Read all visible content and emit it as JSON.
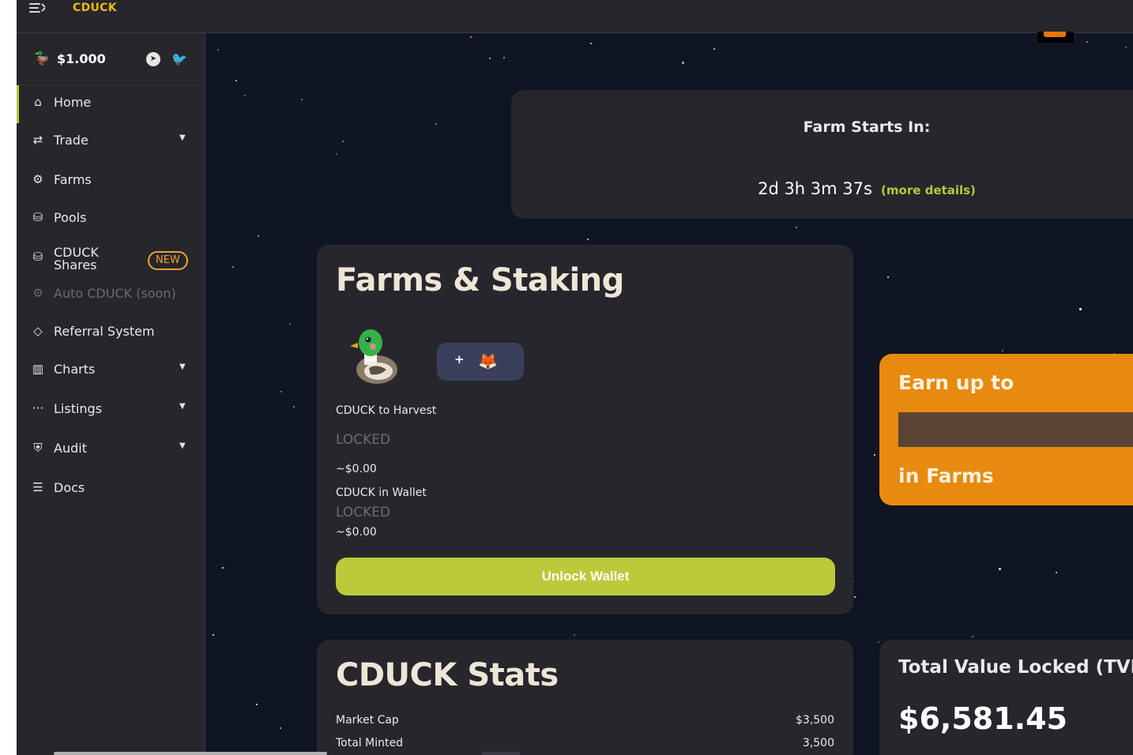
{
  "app": {
    "brand": "CDUCK"
  },
  "sidebar": {
    "price": "$1.000",
    "items": [
      {
        "label": "Home",
        "icon": "home-icon"
      },
      {
        "label": "Trade",
        "icon": "trade-icon"
      },
      {
        "label": "Farms",
        "icon": "tractor-icon"
      },
      {
        "label": "Pools",
        "icon": "pool-icon"
      },
      {
        "label_line1": "CDUCK",
        "label_line2": "Shares",
        "icon": "pool-icon",
        "badge": "NEW"
      },
      {
        "label": "Auto CDUCK (soon)",
        "icon": "tractor-icon"
      },
      {
        "label": "Referral System",
        "icon": "ticket-icon"
      },
      {
        "label": "Charts",
        "icon": "chart-icon"
      },
      {
        "label": "Listings",
        "icon": "more-icon"
      },
      {
        "label": "Audit",
        "icon": "shield-icon"
      },
      {
        "label": "Docs",
        "icon": "docs-icon"
      }
    ]
  },
  "countdown": {
    "heading": "Farm Starts In:",
    "timer": "2d 3h 3m 37s",
    "more_details": "(more details)"
  },
  "farms": {
    "title": "Farms & Staking",
    "add_token_plus": "+",
    "harvest_label": "CDUCK to Harvest",
    "harvest_value": "LOCKED",
    "harvest_usd": "~$0.00",
    "wallet_label": "CDUCK in Wallet",
    "wallet_value": "LOCKED",
    "wallet_usd": "~$0.00",
    "unlock_button": "Unlock Wallet"
  },
  "earn": {
    "top": "Earn up to",
    "bottom": "in Farms"
  },
  "stats": {
    "title": "CDUCK Stats",
    "rows": [
      {
        "label": "Market Cap",
        "value": "$3,500"
      },
      {
        "label": "Total Minted",
        "value": "3,500"
      }
    ]
  },
  "tvl": {
    "title": "Total Value Locked (TVL)",
    "value": "$6,581.45"
  },
  "colors": {
    "accent_green": "#bdc93b",
    "brand_yellow": "#f0b90b",
    "earn_orange": "#e88a10",
    "card_bg": "#27262c",
    "page_bg": "#0f1522"
  }
}
